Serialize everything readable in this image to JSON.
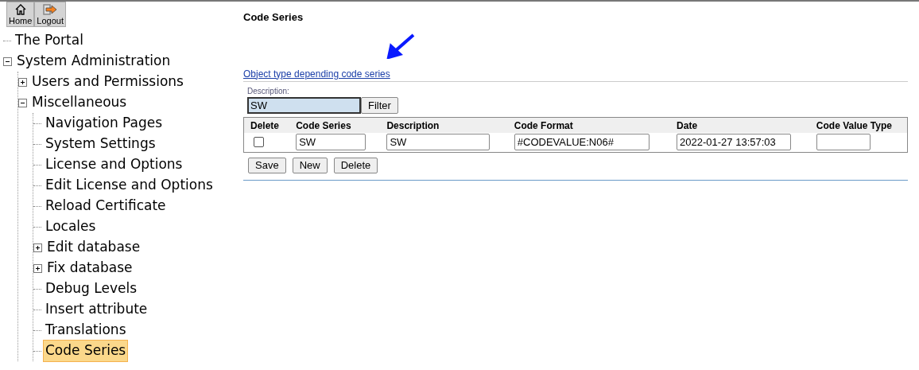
{
  "toolbar": [
    {
      "kind": "home",
      "label": "Home"
    },
    {
      "kind": "logout",
      "label": "Logout"
    }
  ],
  "tree": [
    {
      "label": "The Portal",
      "selected": false
    },
    {
      "label": "System Administration",
      "selected": false,
      "expanded": true,
      "children": [
        {
          "label": "Users and Permissions",
          "selected": false,
          "expanded": false
        },
        {
          "label": "Miscellaneous",
          "selected": false,
          "expanded": true,
          "children": [
            {
              "label": "Navigation Pages",
              "selected": false
            },
            {
              "label": "System Settings",
              "selected": false
            },
            {
              "label": "License and Options",
              "selected": false
            },
            {
              "label": "Edit License and Options",
              "selected": false
            },
            {
              "label": "Reload Certificate",
              "selected": false
            },
            {
              "label": "Locales",
              "selected": false
            },
            {
              "label": "Edit database",
              "selected": false,
              "expanded": false
            },
            {
              "label": "Fix database",
              "selected": false,
              "expanded": false
            },
            {
              "label": "Debug Levels",
              "selected": false
            },
            {
              "label": "Insert attribute",
              "selected": false
            },
            {
              "label": "Translations",
              "selected": false
            },
            {
              "label": "Code Series",
              "selected": true
            }
          ]
        }
      ]
    }
  ],
  "page_title": "Code Series",
  "link": "Object type depending code series",
  "filter": {
    "label": "Description:",
    "value": "SW",
    "button": "Filter"
  },
  "table": {
    "columns": [
      "Delete",
      "Code Series",
      "Description",
      "Code Format",
      "Date",
      "Code Value Type"
    ],
    "rows": [
      {
        "cells": [
          {
            "kind": "checkbox",
            "checked": false
          },
          {
            "kind": "input",
            "value": "SW"
          },
          {
            "kind": "input",
            "value": "SW"
          },
          {
            "kind": "input",
            "value": "#CODEVALUE:N06#"
          },
          {
            "kind": "input",
            "value": "2022-01-27 13:57:03"
          },
          {
            "kind": "input"
          }
        ]
      }
    ]
  },
  "buttons": [
    "Save",
    "New",
    "Delete"
  ]
}
